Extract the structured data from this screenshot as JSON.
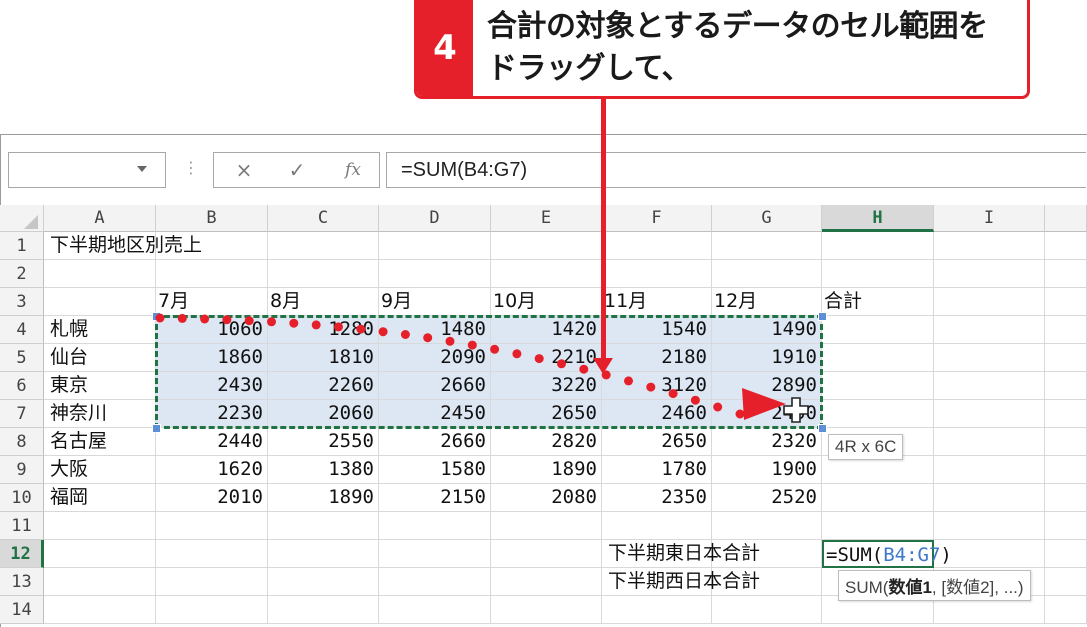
{
  "callout": {
    "step": "4",
    "text_line1": "合計の対象とするデータのセル範囲を",
    "text_line2": "ドラッグして、",
    "color": "#e6202a"
  },
  "ribbon": {
    "name_box_value": "",
    "cancel_icon": "×",
    "enter_icon": "✓",
    "fx_label": "fx",
    "formula": "=SUM(B4:G7)"
  },
  "columns": [
    "A",
    "B",
    "C",
    "D",
    "E",
    "F",
    "G",
    "H",
    "I"
  ],
  "rows": [
    "1",
    "2",
    "3",
    "4",
    "5",
    "6",
    "7",
    "8",
    "9",
    "10",
    "11",
    "12",
    "13",
    "14"
  ],
  "cells": {
    "A1": "下半期地区別売上",
    "B3": "7月",
    "C3": "8月",
    "D3": "9月",
    "E3": "10月",
    "F3": "11月",
    "G3": "12月",
    "H3": "合計",
    "A4": "札幌",
    "A5": "仙台",
    "A6": "東京",
    "A7": "神奈川",
    "A8": "名古屋",
    "A9": "大阪",
    "A10": "福岡",
    "B4": "1060",
    "C4": "1280",
    "D4": "1480",
    "E4": "1420",
    "F4": "1540",
    "G4": "1490",
    "B5": "1860",
    "C5": "1810",
    "D5": "2090",
    "E5": "2210",
    "F5": "2180",
    "G5": "1910",
    "B6": "2430",
    "C6": "2260",
    "D6": "2660",
    "E6": "3220",
    "F6": "3120",
    "G6": "2890",
    "B7": "2230",
    "C7": "2060",
    "D7": "2450",
    "E7": "2650",
    "F7": "2460",
    "G7": "2450",
    "B8": "2440",
    "C8": "2550",
    "D8": "2660",
    "E8": "2820",
    "F8": "2650",
    "G8": "2320",
    "B9": "1620",
    "C9": "1380",
    "D9": "1580",
    "E9": "1890",
    "F9": "1780",
    "G9": "1900",
    "B10": "2010",
    "C10": "1890",
    "D10": "2150",
    "E10": "2080",
    "F10": "2350",
    "G10": "2520",
    "F12": "下半期東日本合計",
    "F13": "下半期西日本合計"
  },
  "active_cell": {
    "prefix": "=SUM(",
    "ref": "B4:G7",
    "suffix": ")"
  },
  "selection_size_tip": "4R x 6C",
  "function_tip": {
    "name": "SUM(",
    "arg1": "数値1",
    "rest": ", [数値2], ...)"
  },
  "colors": {
    "excel_green": "#217346",
    "selection_fill": "#dde6f3",
    "range_ref_blue": "#3d78c9",
    "drag_path_red": "#e6202a"
  },
  "icons": {
    "cursor": "move-cross-icon",
    "name_box_dropdown": "chevron-down-icon"
  }
}
